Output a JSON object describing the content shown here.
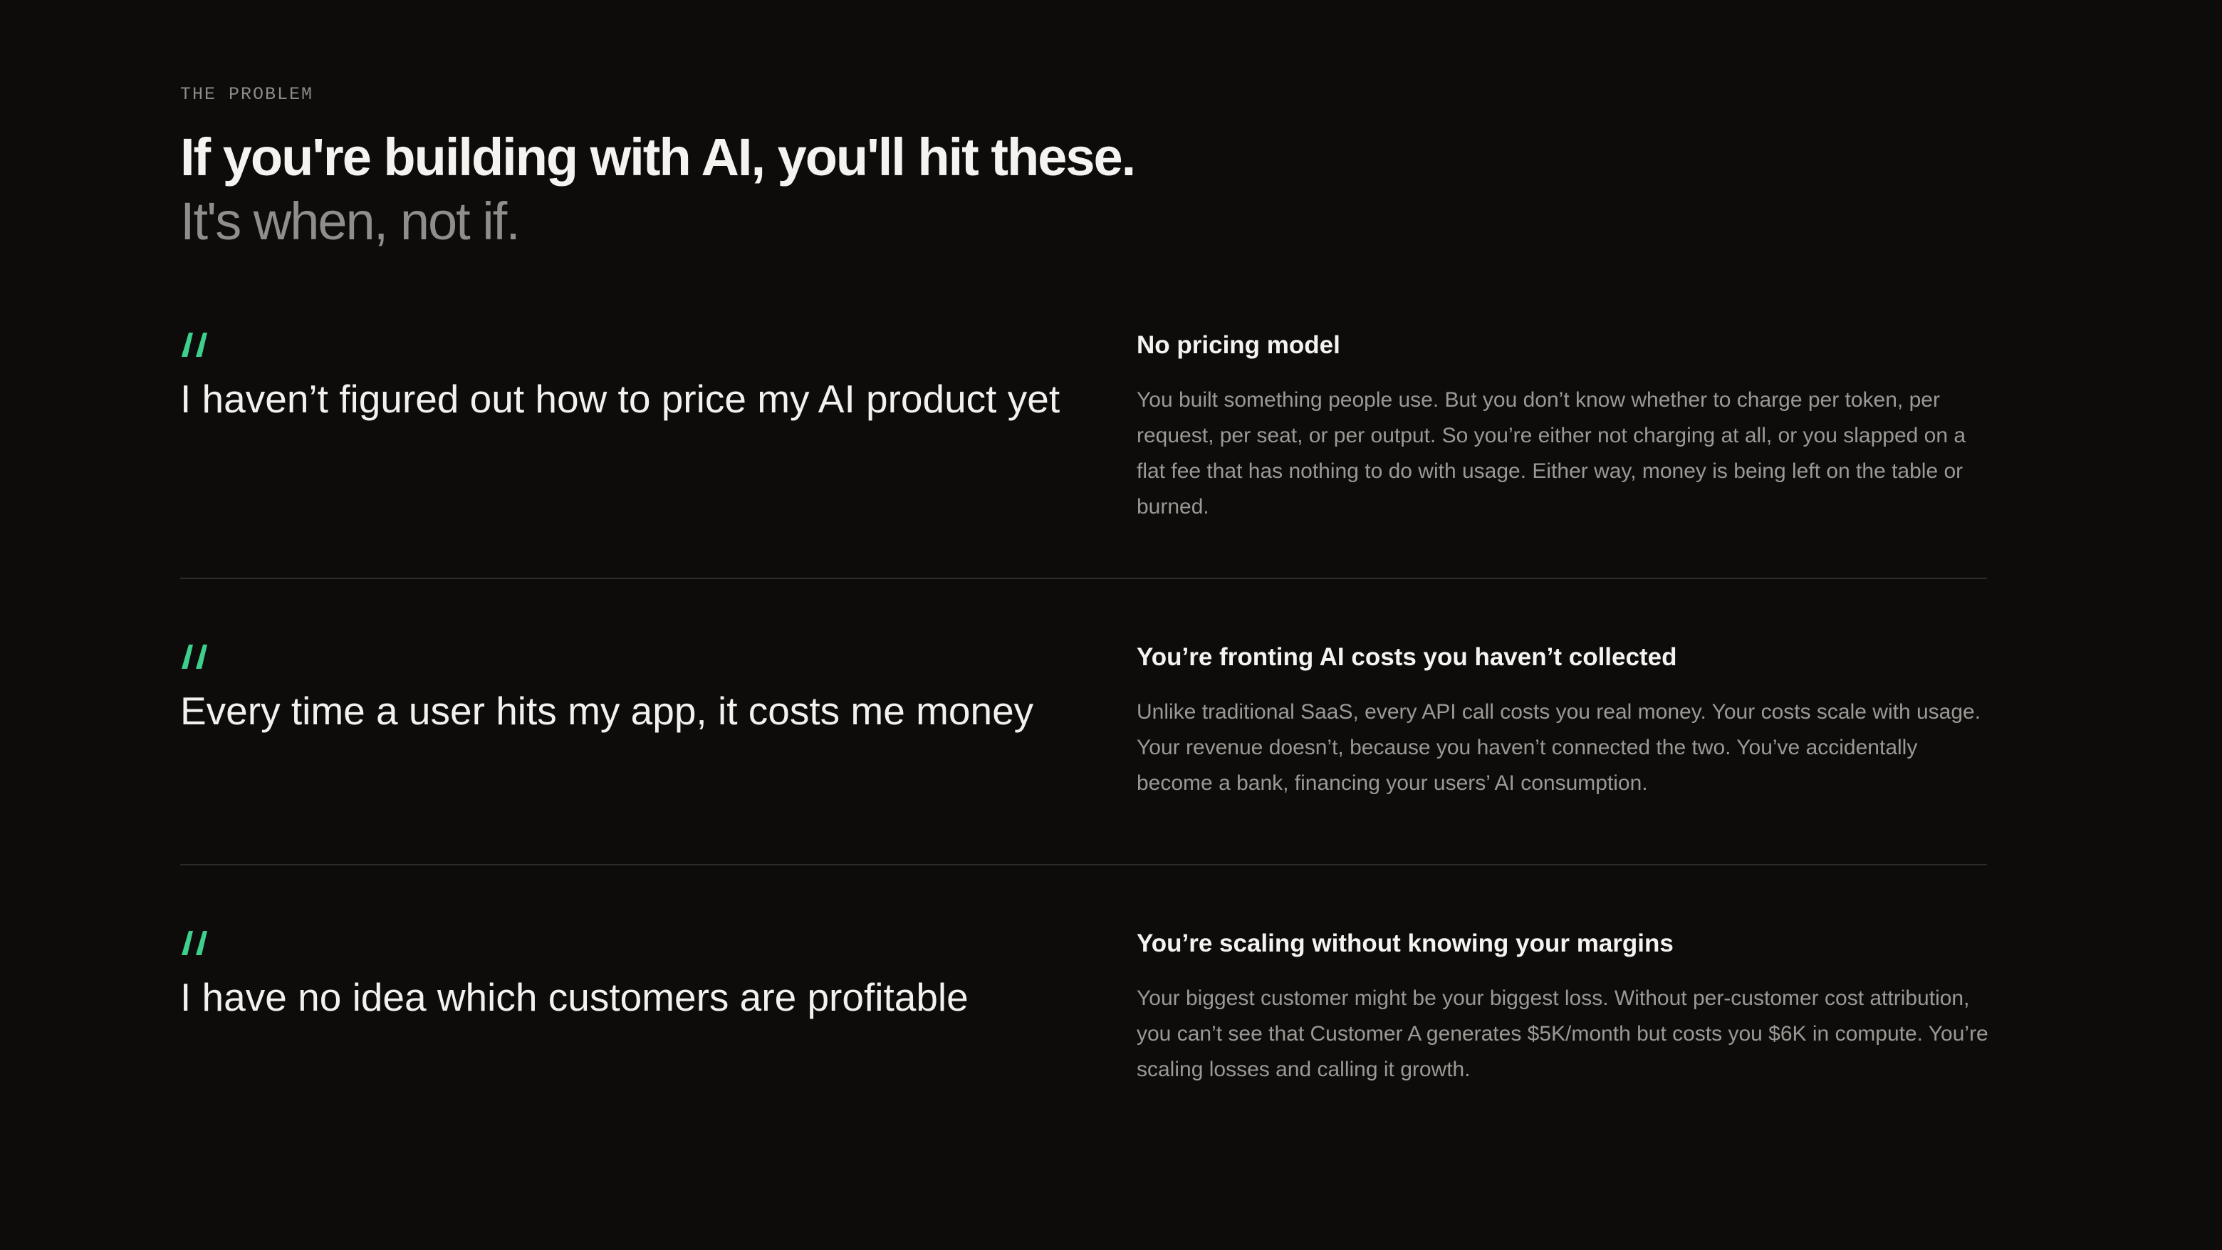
{
  "section": {
    "eyebrow": "THE PROBLEM",
    "headline": "If you're building with AI, you'll hit these.",
    "subheadline": "It's when, not if."
  },
  "accent_color": "#3ecf8e",
  "quote_icon": "quote-icon",
  "rows": [
    {
      "quote": "I haven’t figured out how to price my AI product yet",
      "title": "No pricing model",
      "description": "You built something people use. But you don’t know whether to charge per token, per request, per seat, or per output. So you’re either not charging at all, or you slapped on a flat fee that has nothing to do with usage. Either way, money is being left on the table or burned."
    },
    {
      "quote": "Every time a user hits my app, it costs me money",
      "title": "You’re fronting AI costs you haven’t collected",
      "description": "Unlike traditional SaaS, every API call costs you real money. Your costs scale with usage. Your revenue doesn’t, because you haven’t connected the two. You’ve accidentally become a bank, financing your users’ AI consumption."
    },
    {
      "quote": "I have no idea which customers are profitable",
      "title": "You’re scaling without knowing your margins",
      "description": "Your biggest customer might be your biggest loss. Without per-customer cost attribution, you can’t see that Customer A generates $5K/month but costs you $6K in compute. You’re scaling losses and calling it growth."
    }
  ]
}
